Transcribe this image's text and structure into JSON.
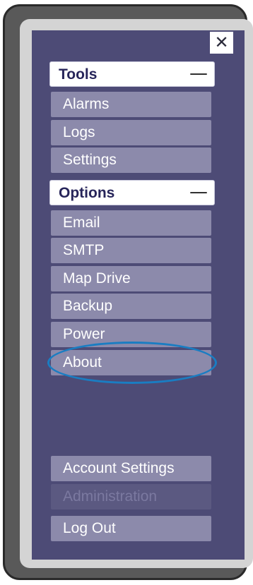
{
  "close_icon": "close-icon",
  "tools": {
    "title": "Tools",
    "toggle": "—",
    "items": [
      "Alarms",
      "Logs",
      "Settings"
    ]
  },
  "options": {
    "title": "Options",
    "toggle": "—",
    "items": [
      "Email",
      "SMTP",
      "Map Drive",
      "Backup",
      "Power",
      "About"
    ]
  },
  "account": {
    "items": [
      "Account Settings",
      "Administration",
      "Log Out"
    ],
    "disabled_item": "Administration"
  },
  "highlighted_item": "About",
  "colors": {
    "panel": "#4d4b76",
    "menu_item": "#8c8aab",
    "highlight": "#1a7dc2"
  }
}
